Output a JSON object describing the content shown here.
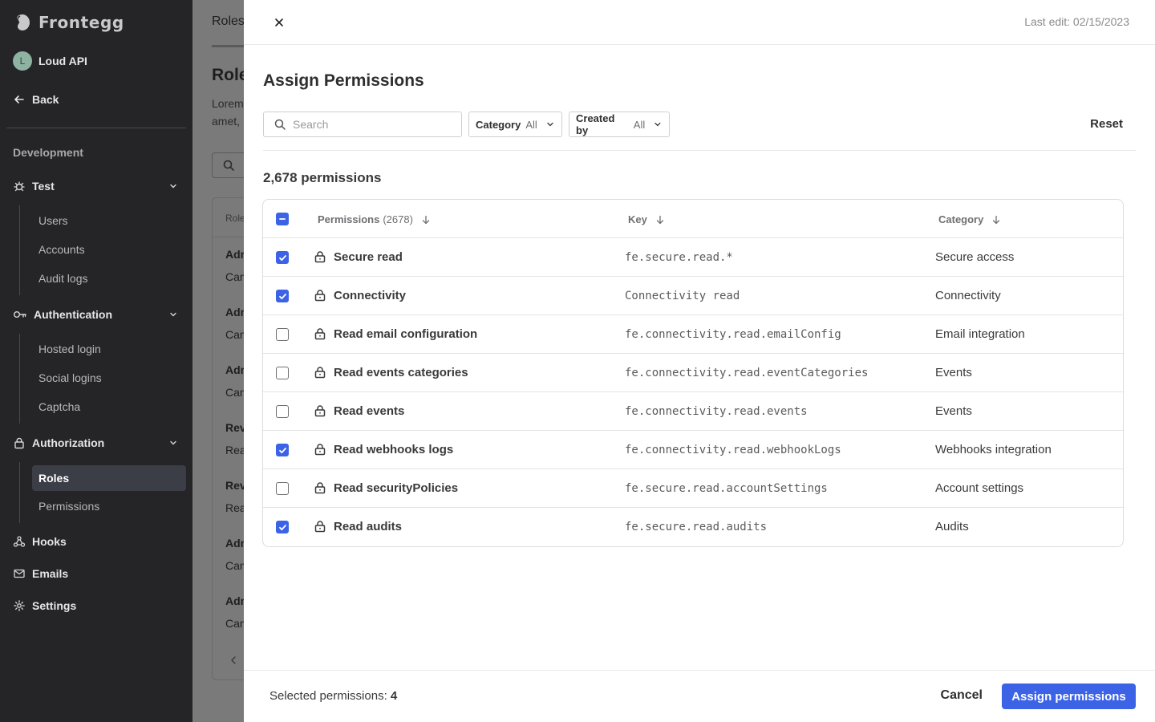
{
  "sidebar": {
    "brand": "Frontegg",
    "account": {
      "initial": "L",
      "name": "Loud API"
    },
    "back_label": "Back",
    "section_label": "Development",
    "groups": [
      {
        "label": "Test",
        "icon": "bug-icon",
        "items": [
          "Users",
          "Accounts",
          "Audit logs"
        ]
      },
      {
        "label": "Authentication",
        "icon": "key-icon",
        "items": [
          "Hosted login",
          "Social logins",
          "Captcha"
        ]
      },
      {
        "label": "Authorization",
        "icon": "lock-icon",
        "items": [
          "Roles",
          "Permissions"
        ]
      }
    ],
    "active_item": "Roles",
    "bottom_items": [
      {
        "label": "Hooks",
        "icon": "hooks-icon"
      },
      {
        "label": "Emails",
        "icon": "mail-icon"
      },
      {
        "label": "Settings",
        "icon": "gear-icon"
      }
    ]
  },
  "background": {
    "tab": "Roles",
    "title": "Role",
    "desc_line1": "Lorem",
    "desc_line2": "amet,",
    "rows": [
      {
        "a": "Adm",
        "b": "Can"
      },
      {
        "a": "Adm",
        "b": "Can"
      },
      {
        "a": "Adm",
        "b": "Can"
      },
      {
        "a": "Rev",
        "b": "Rea"
      },
      {
        "a": "Rev",
        "b": "Rea"
      },
      {
        "a": "Adm",
        "b": "Can"
      },
      {
        "a": "Adm",
        "b": "Can"
      }
    ],
    "table_header": "Role"
  },
  "drawer": {
    "close_label": "×",
    "last_edit": "Last edit: 02/15/2023",
    "title": "Assign Permissions",
    "search_placeholder": "Search",
    "filters": [
      {
        "label": "Category",
        "value": "All"
      },
      {
        "label": "Created by",
        "value": "All"
      }
    ],
    "reset_label": "Reset",
    "count_label": "2,678 permissions",
    "columns": {
      "permissions": "Permissions",
      "permissions_count": "(2678)",
      "key": "Key",
      "category": "Category"
    },
    "rows": [
      {
        "name": "Secure read",
        "key": "fe.secure.read.*",
        "category": "Secure access",
        "checked": true
      },
      {
        "name": "Connectivity",
        "key": "Connectivity read",
        "category": "Connectivity",
        "checked": true
      },
      {
        "name": "Read email configuration",
        "key": "fe.connectivity.read.emailConfig",
        "category": "Email integration",
        "checked": false
      },
      {
        "name": "Read events categories",
        "key": "fe.connectivity.read.eventCategories",
        "category": "Events",
        "checked": false
      },
      {
        "name": "Read events",
        "key": "fe.connectivity.read.events",
        "category": "Events",
        "checked": false
      },
      {
        "name": "Read webhooks logs",
        "key": "fe.connectivity.read.webhookLogs",
        "category": "Webhooks integration",
        "checked": true
      },
      {
        "name": "Read securityPolicies",
        "key": "fe.secure.read.accountSettings",
        "category": "Account settings",
        "checked": false
      },
      {
        "name": "Read audits",
        "key": "fe.secure.read.audits",
        "category": "Audits",
        "checked": true
      }
    ],
    "footer": {
      "selected_label": "Selected permissions:",
      "selected_count": "4",
      "cancel_label": "Cancel",
      "assign_label": "Assign permissions"
    }
  },
  "colors": {
    "accent": "#3c63e6",
    "sidebar_bg": "#252527",
    "overlay": "#7a7a7a"
  }
}
